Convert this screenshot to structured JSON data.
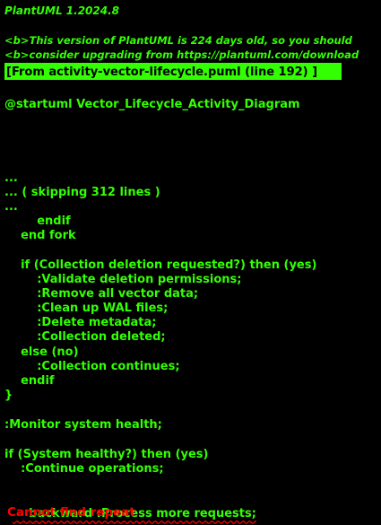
{
  "version": "PlantUML 1.2024.8",
  "warning_lines": [
    "<b>This version of PlantUML is 224 days old, so you should",
    "<b>consider upgrading from https://plantuml.com/download"
  ],
  "source_ref": "[From activity-vector-lifecycle.puml (line 192) ]",
  "code_lines": [
    "@startuml Vector_Lifecycle_Activity_Diagram",
    "...",
    "... ( skipping 312 lines )",
    "...",
    "        endif",
    "    end fork",
    "    if (Collection deletion requested?) then (yes)",
    "        :Validate deletion permissions;",
    "        :Remove all vector data;",
    "        :Clean up WAL files;",
    "        :Delete metadata;",
    "        :Collection deleted;",
    "    else (no)",
    "        :Collection continues;",
    "    endif",
    "}",
    ":Monitor system health;",
    "if (System healthy?) then (yes)",
    "    :Continue operations;",
    "    backward :Process more requests;"
  ],
  "error": "Cannot find repeat",
  "colors": {
    "text": "#33FF02",
    "background": "#000000",
    "error": "#FF0000"
  }
}
